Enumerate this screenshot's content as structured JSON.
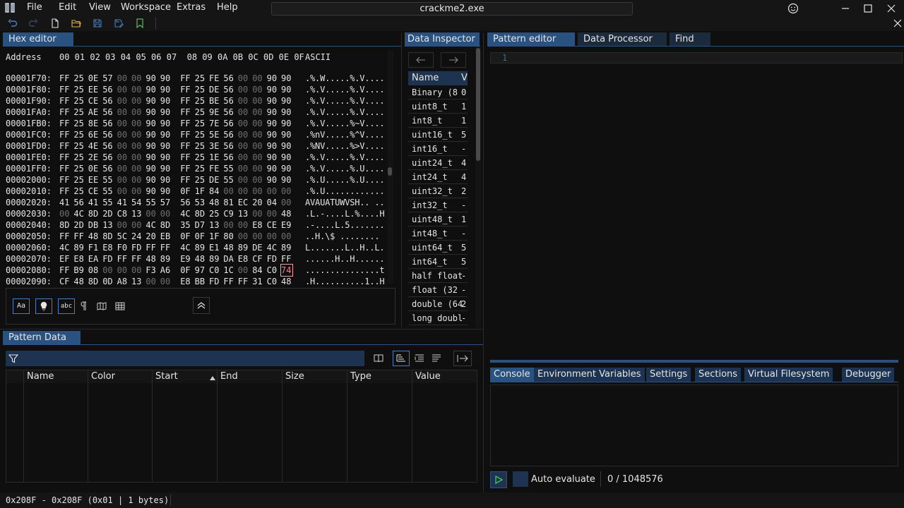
{
  "app": {
    "title": "crackme2.exe",
    "menu": [
      "File",
      "Edit",
      "View",
      "Workspace",
      "Extras",
      "Help"
    ]
  },
  "hex_editor": {
    "tab_label": "Hex editor",
    "header": {
      "address_label": "Address",
      "columns": "00 01 02 03 04 05 06 07  08 09 0A 0B 0C 0D 0E 0F",
      "ascii_label": "ASCII"
    },
    "rows": [
      {
        "addr": "00001F70:",
        "bytes": [
          "FF",
          "25",
          "0E",
          "57",
          "00",
          "00",
          "90",
          "90",
          "FF",
          "25",
          "FE",
          "56",
          "00",
          "00",
          "90",
          "90"
        ],
        "ascii": ".%.W.....%.V...."
      },
      {
        "addr": "00001F80:",
        "bytes": [
          "FF",
          "25",
          "EE",
          "56",
          "00",
          "00",
          "90",
          "90",
          "FF",
          "25",
          "DE",
          "56",
          "00",
          "00",
          "90",
          "90"
        ],
        "ascii": ".%.V.....%.V...."
      },
      {
        "addr": "00001F90:",
        "bytes": [
          "FF",
          "25",
          "CE",
          "56",
          "00",
          "00",
          "90",
          "90",
          "FF",
          "25",
          "BE",
          "56",
          "00",
          "00",
          "90",
          "90"
        ],
        "ascii": ".%.V.....%.V...."
      },
      {
        "addr": "00001FA0:",
        "bytes": [
          "FF",
          "25",
          "AE",
          "56",
          "00",
          "00",
          "90",
          "90",
          "FF",
          "25",
          "9E",
          "56",
          "00",
          "00",
          "90",
          "90"
        ],
        "ascii": ".%.V.....%.V...."
      },
      {
        "addr": "00001FB0:",
        "bytes": [
          "FF",
          "25",
          "8E",
          "56",
          "00",
          "00",
          "90",
          "90",
          "FF",
          "25",
          "7E",
          "56",
          "00",
          "00",
          "90",
          "90"
        ],
        "ascii": ".%.V.....%~V...."
      },
      {
        "addr": "00001FC0:",
        "bytes": [
          "FF",
          "25",
          "6E",
          "56",
          "00",
          "00",
          "90",
          "90",
          "FF",
          "25",
          "5E",
          "56",
          "00",
          "00",
          "90",
          "90"
        ],
        "ascii": ".%nV.....%^V...."
      },
      {
        "addr": "00001FD0:",
        "bytes": [
          "FF",
          "25",
          "4E",
          "56",
          "00",
          "00",
          "90",
          "90",
          "FF",
          "25",
          "3E",
          "56",
          "00",
          "00",
          "90",
          "90"
        ],
        "ascii": ".%NV.....%>V...."
      },
      {
        "addr": "00001FE0:",
        "bytes": [
          "FF",
          "25",
          "2E",
          "56",
          "00",
          "00",
          "90",
          "90",
          "FF",
          "25",
          "1E",
          "56",
          "00",
          "00",
          "90",
          "90"
        ],
        "ascii": ".%.V.....%.V...."
      },
      {
        "addr": "00001FF0:",
        "bytes": [
          "FF",
          "25",
          "0E",
          "56",
          "00",
          "00",
          "90",
          "90",
          "FF",
          "25",
          "FE",
          "55",
          "00",
          "00",
          "90",
          "90"
        ],
        "ascii": ".%.V.....%.U...."
      },
      {
        "addr": "00002000:",
        "bytes": [
          "FF",
          "25",
          "EE",
          "55",
          "00",
          "00",
          "90",
          "90",
          "FF",
          "25",
          "DE",
          "55",
          "00",
          "00",
          "90",
          "90"
        ],
        "ascii": ".%.U.....%.U...."
      },
      {
        "addr": "00002010:",
        "bytes": [
          "FF",
          "25",
          "CE",
          "55",
          "00",
          "00",
          "90",
          "90",
          "0F",
          "1F",
          "84",
          "00",
          "00",
          "00",
          "00",
          "00"
        ],
        "ascii": ".%.U............"
      },
      {
        "addr": "00002020:",
        "bytes": [
          "41",
          "56",
          "41",
          "55",
          "41",
          "54",
          "55",
          "57",
          "56",
          "53",
          "48",
          "81",
          "EC",
          "20",
          "04",
          "00"
        ],
        "ascii": "AVAUATUWVSH.. .."
      },
      {
        "addr": "00002030:",
        "bytes": [
          "00",
          "4C",
          "8D",
          "2D",
          "C8",
          "13",
          "00",
          "00",
          "4C",
          "8D",
          "25",
          "C9",
          "13",
          "00",
          "00",
          "48"
        ],
        "ascii": ".L.-....L.%....H"
      },
      {
        "addr": "00002040:",
        "bytes": [
          "8D",
          "2D",
          "DB",
          "13",
          "00",
          "00",
          "4C",
          "8D",
          "35",
          "D7",
          "13",
          "00",
          "00",
          "E8",
          "CE",
          "E9"
        ],
        "ascii": ".-....L.5......."
      },
      {
        "addr": "00002050:",
        "bytes": [
          "FF",
          "FF",
          "48",
          "8D",
          "5C",
          "24",
          "20",
          "EB",
          "0F",
          "0F",
          "1F",
          "80",
          "00",
          "00",
          "00",
          "00"
        ],
        "ascii": "..H.\\$ ........"
      },
      {
        "addr": "00002060:",
        "bytes": [
          "4C",
          "89",
          "F1",
          "E8",
          "F0",
          "FD",
          "FF",
          "FF",
          "4C",
          "89",
          "E1",
          "48",
          "89",
          "DE",
          "4C",
          "89"
        ],
        "ascii": "L.......L..H..L."
      },
      {
        "addr": "00002070:",
        "bytes": [
          "EF",
          "E8",
          "EA",
          "FD",
          "FF",
          "FF",
          "48",
          "89",
          "E9",
          "48",
          "89",
          "DA",
          "E8",
          "CF",
          "FD",
          "FF"
        ],
        "ascii": "......H..H......"
      },
      {
        "addr": "00002080:",
        "bytes": [
          "FF",
          "B9",
          "08",
          "00",
          "00",
          "00",
          "F3",
          "A6",
          "0F",
          "97",
          "C0",
          "1C",
          "00",
          "84",
          "C0",
          "74"
        ],
        "ascii": "...............t"
      },
      {
        "addr": "00002090:",
        "bytes": [
          "CF",
          "48",
          "8D",
          "0D",
          "A8",
          "13",
          "00",
          "00",
          "E8",
          "BB",
          "FD",
          "FF",
          "FF",
          "31",
          "C0",
          "48"
        ],
        "ascii": ".H..........1..H"
      }
    ]
  },
  "data_inspector": {
    "tab_label": "Data Inspector",
    "col_name": "Name",
    "col_value": "V",
    "rows": [
      {
        "name": "Binary (8",
        "value": "0"
      },
      {
        "name": "uint8_t",
        "value": "1"
      },
      {
        "name": "int8_t",
        "value": "1"
      },
      {
        "name": "uint16_t",
        "value": "5"
      },
      {
        "name": "int16_t",
        "value": "-"
      },
      {
        "name": "uint24_t",
        "value": "4"
      },
      {
        "name": "int24_t",
        "value": "4"
      },
      {
        "name": "uint32_t",
        "value": "2"
      },
      {
        "name": "int32_t",
        "value": "-"
      },
      {
        "name": "uint48_t",
        "value": "1"
      },
      {
        "name": "int48_t",
        "value": "-"
      },
      {
        "name": "uint64_t",
        "value": "5"
      },
      {
        "name": "int64_t",
        "value": "5"
      },
      {
        "name": "half float",
        "value": "-"
      },
      {
        "name": "float (32",
        "value": "-"
      },
      {
        "name": "double (64",
        "value": "2"
      },
      {
        "name": "long doubl",
        "value": "-"
      }
    ]
  },
  "pattern_editor": {
    "tabs": [
      "Pattern editor",
      "Data Processor",
      "Find"
    ],
    "line_number": "1"
  },
  "pattern_data": {
    "tab_label": "Pattern Data",
    "columns": [
      "Name",
      "Color",
      "Start",
      "End",
      "Size",
      "Type",
      "Value"
    ]
  },
  "console": {
    "tabs": [
      "Console",
      "Environment Variables",
      "Settings",
      "Sections",
      "Virtual Filesystem",
      "Debugger"
    ],
    "auto_evaluate_label": "Auto evaluate",
    "counter": "0 / 1048576"
  },
  "hex_footer": {
    "buttons": [
      "Aa",
      "abc"
    ]
  },
  "status": {
    "selection": "0x208F - 0x208F (0x01 | 1 bytes)"
  },
  "colors": {
    "accent": "#2a5281",
    "highlight": "#f08090"
  }
}
